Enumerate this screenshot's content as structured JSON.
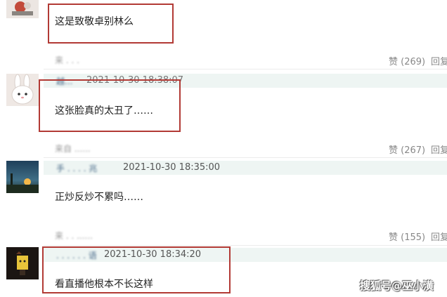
{
  "comments": [
    {
      "text": "这是致敬卓别林么",
      "like": "赞 (269)",
      "reply": "回复"
    },
    {
      "time": "2021-10-30 18:38:07",
      "text": "这张脸真的太丑了……",
      "like": "赞 (267)",
      "reply": "回复"
    },
    {
      "time": "2021-10-30 18:35:00",
      "text": "正炒反炒不累吗……",
      "like": "赞 (155)",
      "reply": "回复"
    },
    {
      "time": "2021-10-30 18:34:20",
      "text": "看直播他根本不长这样"
    }
  ],
  "watermark": "搜狐号@巫小潢"
}
